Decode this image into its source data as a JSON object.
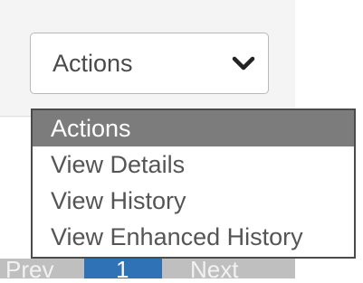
{
  "select": {
    "selected": "Actions",
    "options": [
      {
        "label": "Actions",
        "selected": true
      },
      {
        "label": "View Details",
        "selected": false
      },
      {
        "label": "View History",
        "selected": false
      },
      {
        "label": "View Enhanced History",
        "selected": false
      }
    ]
  },
  "pager": {
    "prev_label": "Prev",
    "current_page": "1",
    "next_label": "Next"
  },
  "colors": {
    "highlight": "#7c7c7c",
    "pager_active": "#2f73b6",
    "dropdown_border": "#4b4b4b"
  },
  "icons": {
    "chevron": "chevron-down-icon"
  }
}
